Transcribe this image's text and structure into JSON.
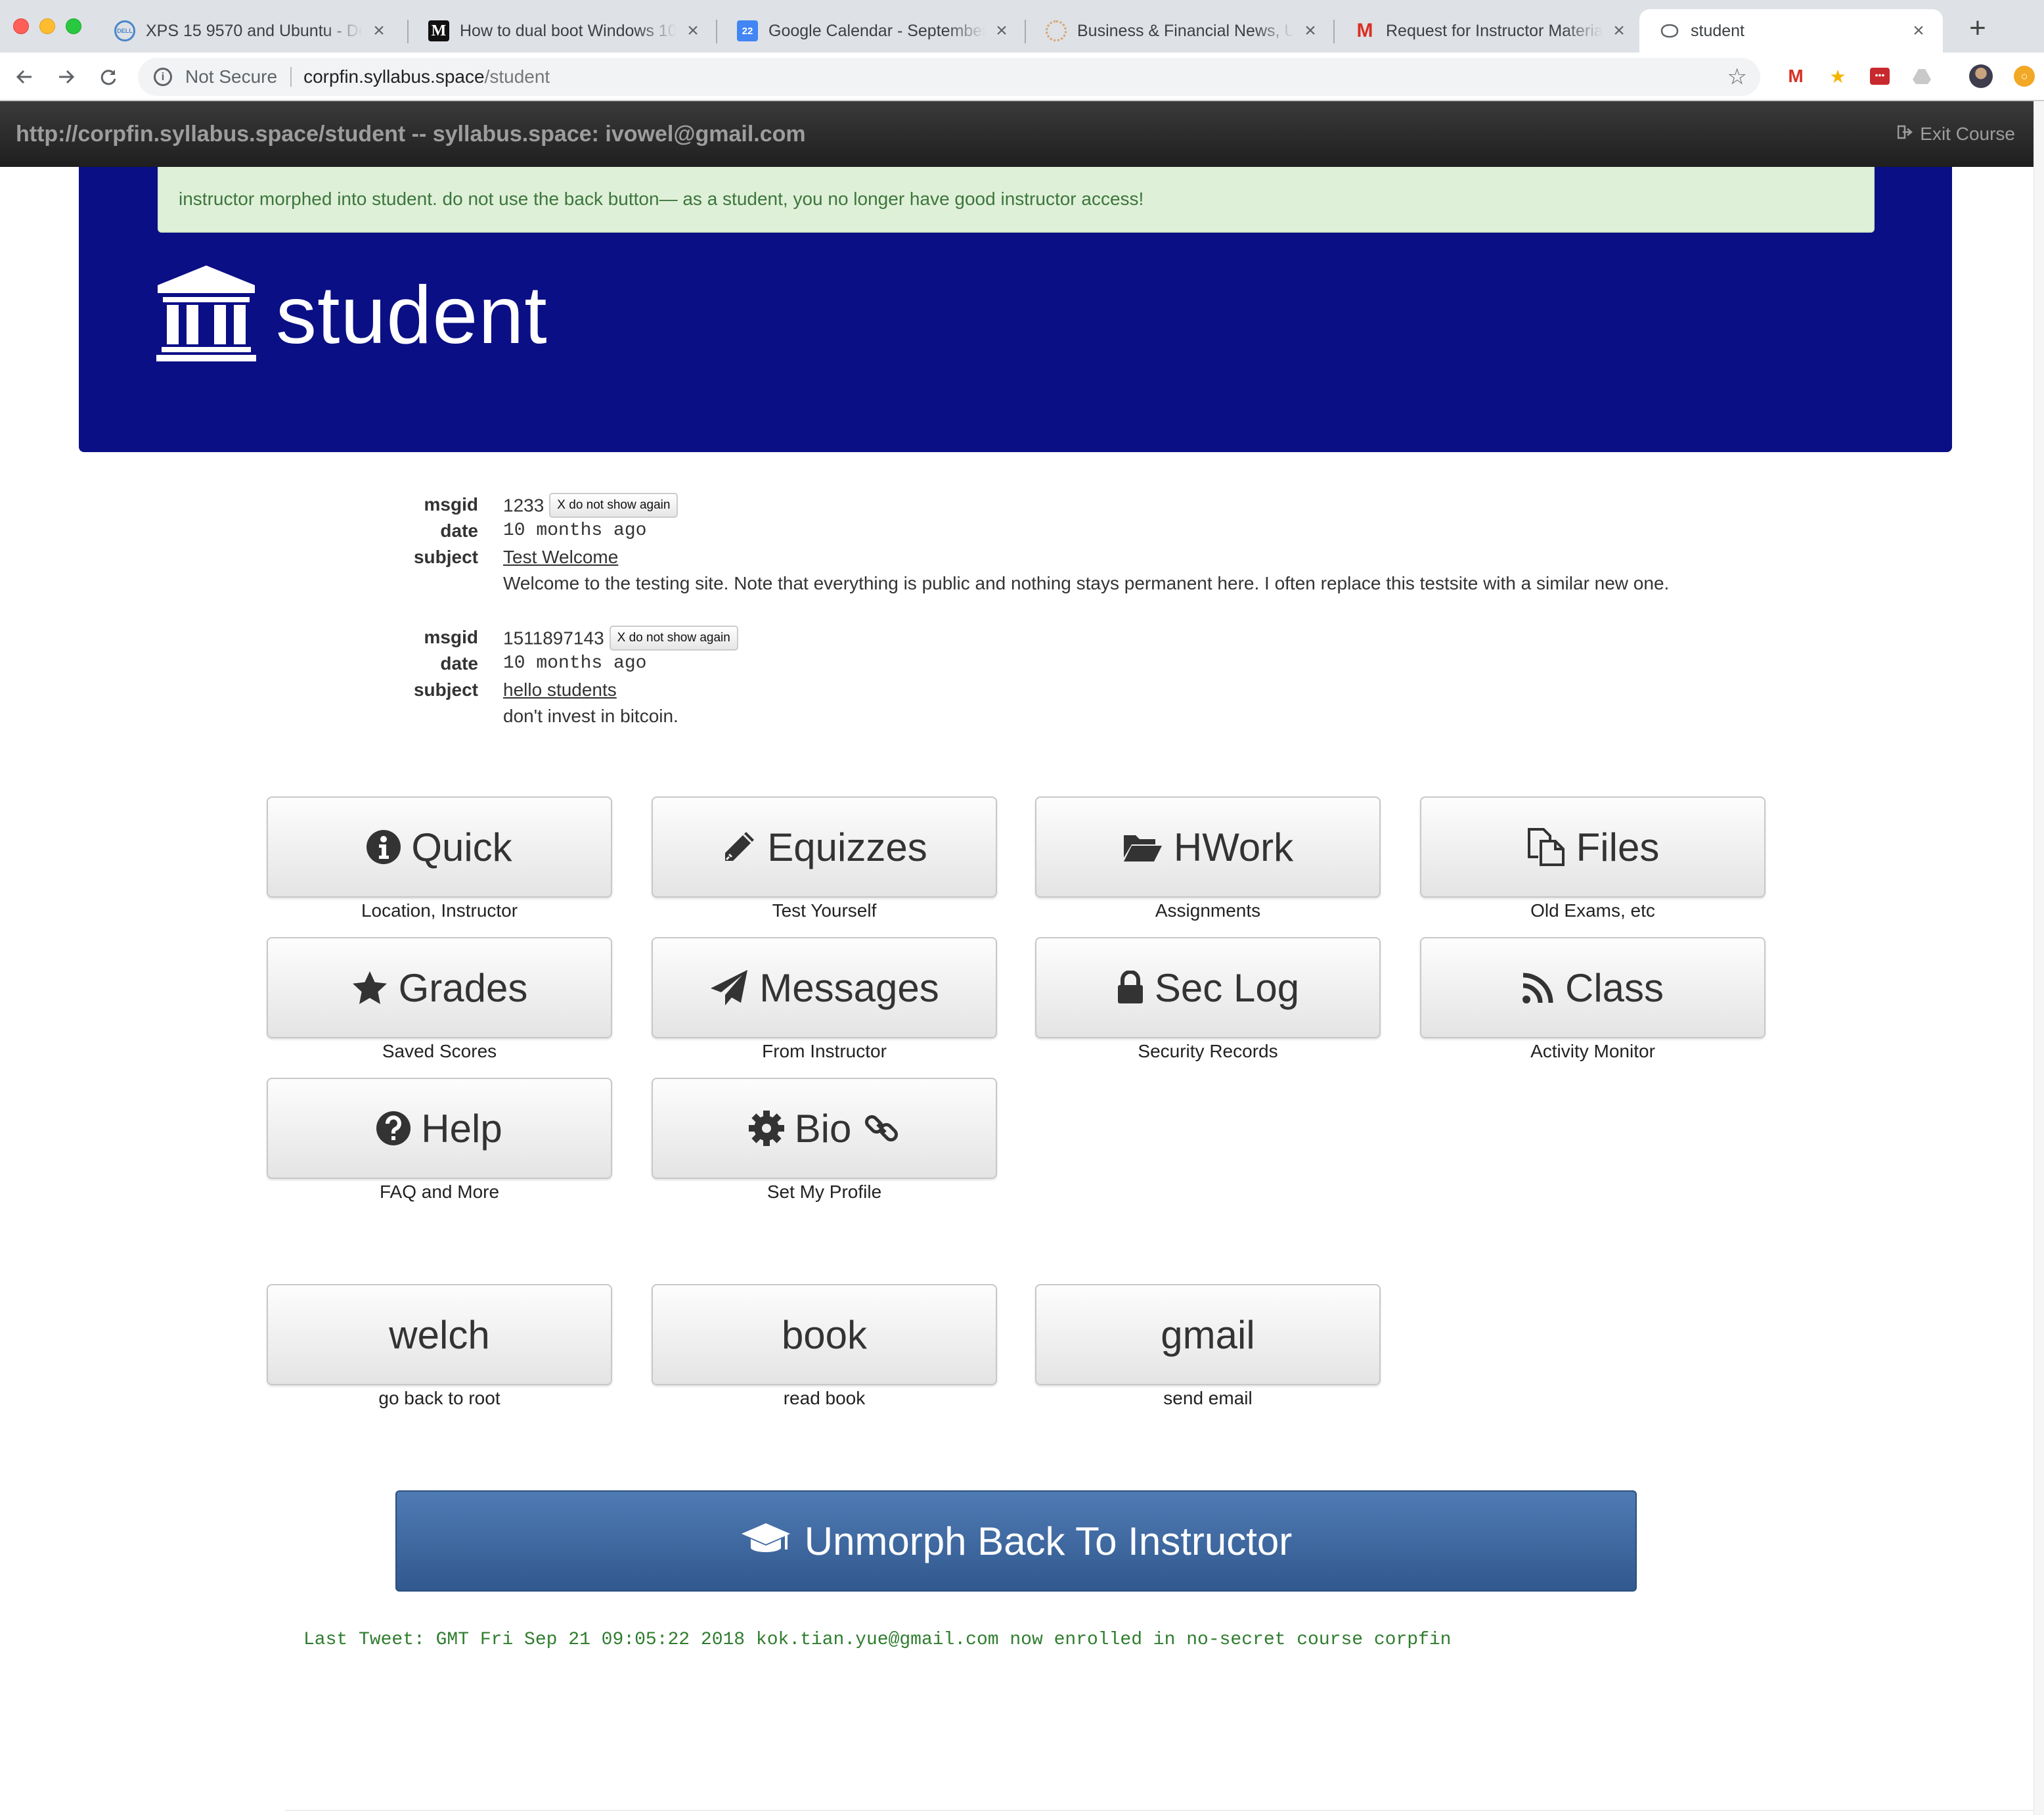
{
  "browser": {
    "tabs": [
      {
        "title": "XPS 15 9570 and Ubuntu - Dell Community",
        "icon": "dell-icon"
      },
      {
        "title": "How to dual boot Windows 10 and Linux",
        "icon": "medium-icon"
      },
      {
        "title": "Google Calendar - September 2018",
        "icon": "calendar-icon",
        "icon_text": "22"
      },
      {
        "title": "Business & Financial News, U.S. & International",
        "icon": "wsj-icon"
      },
      {
        "title": "Request for Instructor Materials",
        "icon": "gmail-icon"
      },
      {
        "title": "student",
        "icon": "page-icon"
      }
    ],
    "address": {
      "security": "Not Secure",
      "host": "corpfin.syllabus.space",
      "path": "/student"
    },
    "accent": "#0b0f85"
  },
  "navbar": {
    "brand": "http://corpfin.syllabus.space/student -- syllabus.space: ivowel@gmail.com",
    "exit_label": "Exit Course"
  },
  "alert": {
    "text": "instructor morphed into student. do not use the back button— as a student, you no longer have good instructor access!"
  },
  "hero": {
    "title": "student",
    "icon": "institution-icon"
  },
  "messages": [
    {
      "msgid_label": "msgid",
      "msgid": "1233",
      "dismiss_label": "X do not show again",
      "date_label": "date",
      "date": "10 months ago",
      "subject_label": "subject",
      "subject": "Test Welcome",
      "body": "Welcome to the testing site. Note that everything is public and nothing stays permanent here. I often replace this testsite with a similar new one."
    },
    {
      "msgid_label": "msgid",
      "msgid": "1511897143",
      "dismiss_label": "X do not show again",
      "date_label": "date",
      "date": "10 months ago",
      "subject_label": "subject",
      "subject": "hello students",
      "body": "don't invest in bitcoin."
    }
  ],
  "tiles": [
    {
      "label": "Quick",
      "caption": "Location, Instructor",
      "icon": "info-circle-icon"
    },
    {
      "label": "Equizzes",
      "caption": "Test Yourself",
      "icon": "pencil-icon"
    },
    {
      "label": "HWork",
      "caption": "Assignments",
      "icon": "folder-open-icon"
    },
    {
      "label": "Files",
      "caption": "Old Exams, etc",
      "icon": "files-icon"
    },
    {
      "label": "Grades",
      "caption": "Saved Scores",
      "icon": "star-icon"
    },
    {
      "label": "Messages",
      "caption": "From Instructor",
      "icon": "send-icon"
    },
    {
      "label": "Sec Log",
      "caption": "Security Records",
      "icon": "lock-icon"
    },
    {
      "label": "Class",
      "caption": "Activity Monitor",
      "icon": "rss-icon"
    },
    {
      "label": "Help",
      "caption": "FAQ and More",
      "icon": "question-circle-icon"
    },
    {
      "label": "Bio",
      "caption": "Set My Profile",
      "icon": "cog-icon",
      "icon_after": "link-icon"
    }
  ],
  "links": [
    {
      "label": "welch",
      "caption": "go back to root"
    },
    {
      "label": "book",
      "caption": "read book"
    },
    {
      "label": "gmail",
      "caption": "send email"
    }
  ],
  "unmorph": {
    "label": "Unmorph Back To Instructor",
    "icon": "graduation-cap-icon",
    "color": "#3d679f"
  },
  "tweet": "Last Tweet: GMT Fri Sep 21 09:05:22 2018 kok.tian.yue@gmail.com now enrolled in no-secret course corpfin"
}
